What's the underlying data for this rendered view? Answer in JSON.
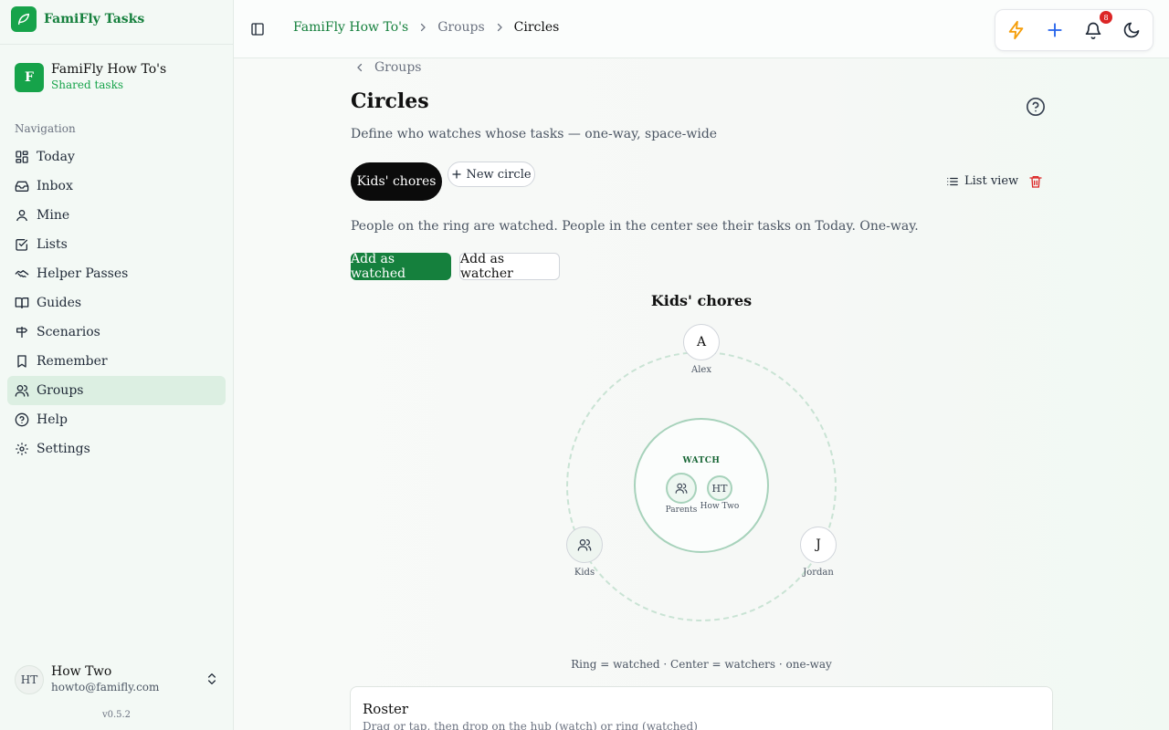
{
  "app": {
    "name": "FamiFly Tasks",
    "version": "v0.5.2"
  },
  "space": {
    "initial": "F",
    "name": "FamiFly How To's",
    "subtitle": "Shared tasks"
  },
  "nav": {
    "heading": "Navigation",
    "items": [
      {
        "label": "Today",
        "icon": "grid-icon"
      },
      {
        "label": "Inbox",
        "icon": "inbox-icon"
      },
      {
        "label": "Mine",
        "icon": "user-icon"
      },
      {
        "label": "Lists",
        "icon": "checkbox-icon"
      },
      {
        "label": "Helper Passes",
        "icon": "handshake-icon"
      },
      {
        "label": "Guides",
        "icon": "book-icon"
      },
      {
        "label": "Scenarios",
        "icon": "signpost-icon"
      },
      {
        "label": "Remember",
        "icon": "bookmark-icon"
      },
      {
        "label": "Groups",
        "icon": "users-icon",
        "active": true
      },
      {
        "label": "Help",
        "icon": "help-circle-icon"
      },
      {
        "label": "Settings",
        "icon": "gear-icon"
      }
    ]
  },
  "user": {
    "initials": "HT",
    "name": "How Two",
    "email": "howto@famifly.com"
  },
  "breadcrumb": [
    "FamiFly How To's",
    "Groups",
    "Circles"
  ],
  "header": {
    "notification_count": "8"
  },
  "page": {
    "back_label": "Groups",
    "title": "Circles",
    "description": "Define who watches whose tasks — one-way, space-wide",
    "active_circle": "Kids' chores",
    "new_circle_label": "New circle",
    "list_view_label": "List view",
    "explanation": "People on the ring are watched. People in the center see their tasks on Today. One-way.",
    "add_watched_label": "Add as watched",
    "add_watcher_label": "Add as watcher"
  },
  "circle": {
    "title": "Kids' chores",
    "hub_label": "WATCH",
    "watchers": [
      {
        "name": "Parents",
        "initials": ""
      },
      {
        "name": "How Two",
        "initials": "HT"
      }
    ],
    "watched": [
      {
        "name": "Alex",
        "initials": "A"
      },
      {
        "name": "Kids",
        "initials": ""
      },
      {
        "name": "Jordan",
        "initials": "J"
      }
    ],
    "legend": "Ring = watched · Center = watchers · one-way"
  },
  "roster": {
    "title": "Roster",
    "hint": "Drag or tap, then drop on the hub (watch) or ring (watched)"
  },
  "colors": {
    "accent": "#15803d",
    "brand": "#16a34a",
    "active_nav": "#dcefe2",
    "danger": "#dc2626",
    "lightning": "#f59e0b",
    "plus": "#2563eb"
  }
}
